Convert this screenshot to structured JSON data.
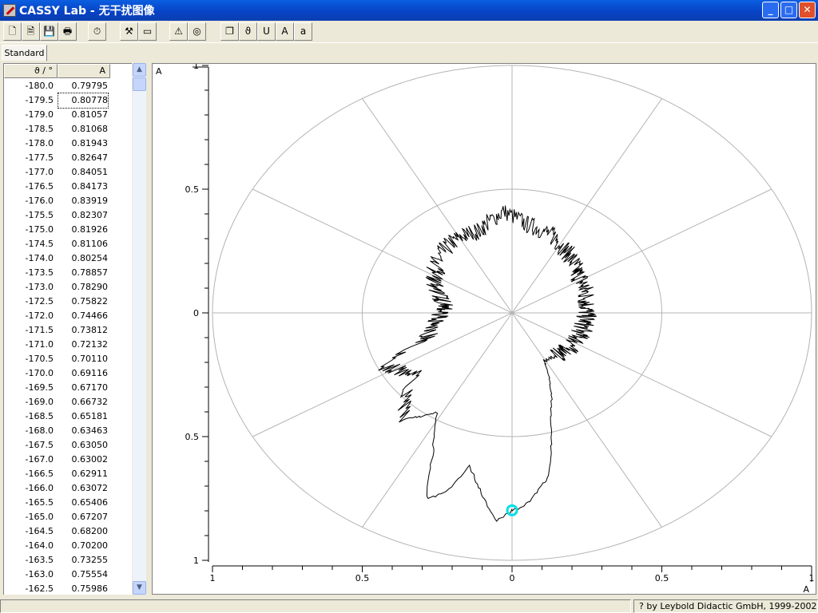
{
  "window": {
    "title": "CASSY Lab - 无干扰图像",
    "minimize": "_",
    "maximize": "□",
    "close": "✕"
  },
  "toolbar": {
    "buttons": [
      {
        "icon": "new-file-icon",
        "label": ""
      },
      {
        "icon": "open-file-icon",
        "label": ""
      },
      {
        "icon": "save-file-icon",
        "label": ""
      },
      {
        "icon": "print-icon",
        "label": ""
      },
      {
        "icon": "stopwatch-icon",
        "label": ""
      },
      {
        "icon": "settings-tools-icon",
        "label": ""
      },
      {
        "icon": "display-icon",
        "label": ""
      },
      {
        "icon": "help-icon",
        "label": ""
      },
      {
        "icon": "cassy-icon",
        "label": ""
      },
      {
        "icon": "windows-icon",
        "label": ""
      },
      {
        "icon": "theta-icon",
        "label": "ϑ"
      },
      {
        "icon": "voltage-icon",
        "label": "U"
      },
      {
        "icon": "current-icon",
        "label": "A"
      },
      {
        "icon": "small-a-icon",
        "label": "a"
      }
    ]
  },
  "tabs": [
    {
      "label": "Standard",
      "active": true
    }
  ],
  "table": {
    "columns": [
      "ϑ / °",
      "A"
    ],
    "rows": [
      [
        "-180.0",
        "0.79795"
      ],
      [
        "-179.5",
        "0.80778"
      ],
      [
        "-179.0",
        "0.81057"
      ],
      [
        "-178.5",
        "0.81068"
      ],
      [
        "-178.0",
        "0.81943"
      ],
      [
        "-177.5",
        "0.82647"
      ],
      [
        "-177.0",
        "0.84051"
      ],
      [
        "-176.5",
        "0.84173"
      ],
      [
        "-176.0",
        "0.83919"
      ],
      [
        "-175.5",
        "0.82307"
      ],
      [
        "-175.0",
        "0.81926"
      ],
      [
        "-174.5",
        "0.81106"
      ],
      [
        "-174.0",
        "0.80254"
      ],
      [
        "-173.5",
        "0.78857"
      ],
      [
        "-173.0",
        "0.78290"
      ],
      [
        "-172.5",
        "0.75822"
      ],
      [
        "-172.0",
        "0.74466"
      ],
      [
        "-171.5",
        "0.73812"
      ],
      [
        "-171.0",
        "0.72132"
      ],
      [
        "-170.5",
        "0.70110"
      ],
      [
        "-170.0",
        "0.69116"
      ],
      [
        "-169.5",
        "0.67170"
      ],
      [
        "-169.0",
        "0.66732"
      ],
      [
        "-168.5",
        "0.65181"
      ],
      [
        "-168.0",
        "0.63463"
      ],
      [
        "-167.5",
        "0.63050"
      ],
      [
        "-167.0",
        "0.63002"
      ],
      [
        "-166.5",
        "0.62911"
      ],
      [
        "-166.0",
        "0.63072"
      ],
      [
        "-165.5",
        "0.65406"
      ],
      [
        "-165.0",
        "0.67207"
      ],
      [
        "-164.5",
        "0.68200"
      ],
      [
        "-164.0",
        "0.70200"
      ],
      [
        "-163.5",
        "0.73255"
      ],
      [
        "-163.0",
        "0.75554"
      ],
      [
        "-162.5",
        "0.75986"
      ]
    ],
    "selected_row": 1
  },
  "chart_data": {
    "type": "line",
    "polar": true,
    "xlabel": "A",
    "ylabel": "A",
    "xlim": [
      -1,
      1
    ],
    "ylim": [
      -1,
      1
    ],
    "x_ticks": [
      "1",
      "0.5",
      "0",
      "0.5",
      "1"
    ],
    "y_ticks": [
      "1",
      "0.5",
      "0",
      "0.5",
      "1"
    ],
    "rings": [
      0.5,
      1
    ],
    "spokes_deg": 30,
    "series": [
      {
        "color": "#000000",
        "curve_anchor_deg_r": [
          [
            -180,
            0.8
          ],
          [
            -176.5,
            0.84
          ],
          [
            -170,
            0.69
          ],
          [
            -167,
            0.63
          ],
          [
            -163,
            0.76
          ],
          [
            -159,
            0.8
          ],
          [
            -155,
            0.62
          ],
          [
            -148,
            0.47
          ],
          [
            -140,
            0.56
          ],
          [
            -127,
            0.41
          ],
          [
            -116,
            0.48
          ],
          [
            -110,
            0.3
          ],
          [
            -95,
            0.24
          ],
          [
            -81,
            0.23
          ],
          [
            -60,
            0.3
          ],
          [
            -35,
            0.35
          ],
          [
            -18,
            0.35
          ],
          [
            -4,
            0.41
          ],
          [
            8,
            0.36
          ],
          [
            23,
            0.34
          ],
          [
            53,
            0.27
          ],
          [
            85,
            0.25
          ],
          [
            123,
            0.24
          ],
          [
            151,
            0.22
          ],
          [
            163,
            0.44
          ],
          [
            170,
            0.68
          ],
          [
            176,
            0.77
          ],
          [
            180,
            0.8
          ]
        ]
      }
    ],
    "marker": {
      "color": "#00e0e8",
      "angle_deg": -180,
      "value": 0.79795
    }
  },
  "status": {
    "left": "",
    "right": "? by Leybold Didactic GmbH, 1999-2002"
  }
}
